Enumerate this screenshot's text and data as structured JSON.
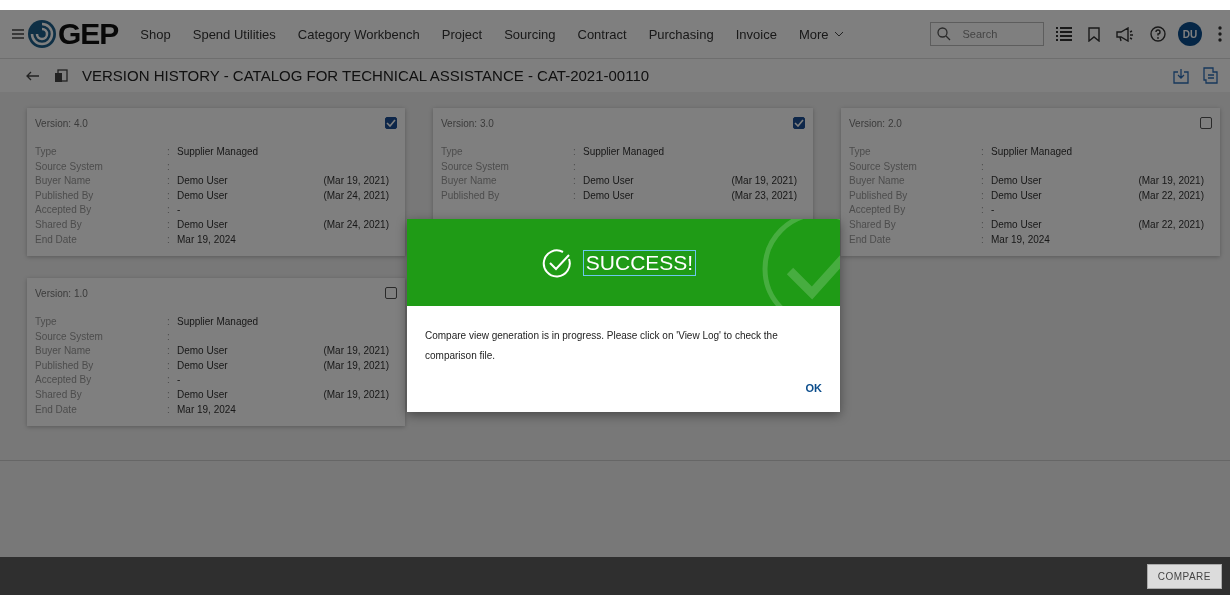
{
  "header": {
    "logo": "GEP",
    "nav": [
      "Shop",
      "Spend Utilities",
      "Category Workbench",
      "Project",
      "Sourcing",
      "Contract",
      "Purchasing",
      "Invoice"
    ],
    "more": "More",
    "search": {
      "placeholder": "Search"
    },
    "avatar": "DU"
  },
  "title": "VERSION HISTORY - CATALOG FOR TECHNICAL ASSISTANCE - CAT-2021-00110",
  "cards": [
    {
      "version": "Version: 4.0",
      "checked": true,
      "rows": [
        {
          "label": "Type",
          "sep": ":",
          "value": "Supplier Managed"
        },
        {
          "label": "Source System",
          "sep": ":"
        },
        {
          "label": "Buyer Name",
          "sep": ":",
          "value": "Demo User",
          "date": "(Mar 19, 2021)"
        },
        {
          "label": "Published By",
          "sep": ":",
          "value": "Demo User",
          "date": "(Mar 24, 2021)"
        },
        {
          "label": "Accepted By",
          "sep": ":",
          "value": "-"
        },
        {
          "label": "Shared By",
          "sep": ":",
          "value": "Demo User",
          "date": "(Mar 24, 2021)"
        },
        {
          "label": "End Date",
          "sep": ":",
          "value": "Mar 19, 2024"
        }
      ]
    },
    {
      "version": "Version: 3.0",
      "checked": true,
      "rows": [
        {
          "label": "Type",
          "sep": ":",
          "value": "Supplier Managed"
        },
        {
          "label": "Source System",
          "sep": ":"
        },
        {
          "label": "Buyer Name",
          "sep": ":",
          "value": "Demo User",
          "date": "(Mar 19, 2021)"
        },
        {
          "label": "Published By",
          "sep": ":",
          "value": "Demo User",
          "date": "(Mar 23, 2021)"
        }
      ]
    },
    {
      "version": "Version: 2.0",
      "checked": false,
      "rows": [
        {
          "label": "Type",
          "sep": ":",
          "value": "Supplier Managed"
        },
        {
          "label": "Source System",
          "sep": ":"
        },
        {
          "label": "Buyer Name",
          "sep": ":",
          "value": "Demo User",
          "date": "(Mar 19, 2021)"
        },
        {
          "label": "Published By",
          "sep": ":",
          "value": "Demo User",
          "date": "(Mar 22, 2021)"
        },
        {
          "label": "Accepted By",
          "sep": ":",
          "value": "-"
        },
        {
          "label": "Shared By",
          "sep": ":",
          "value": "Demo User",
          "date": "(Mar 22, 2021)"
        },
        {
          "label": "End Date",
          "sep": ":",
          "value": "Mar 19, 2024"
        }
      ]
    },
    {
      "version": "Version: 1.0",
      "checked": false,
      "rows": [
        {
          "label": "Type",
          "sep": ":",
          "value": "Supplier Managed"
        },
        {
          "label": "Source System",
          "sep": ":"
        },
        {
          "label": "Buyer Name",
          "sep": ":",
          "value": "Demo User",
          "date": "(Mar 19, 2021)"
        },
        {
          "label": "Published By",
          "sep": ":",
          "value": "Demo User",
          "date": "(Mar 19, 2021)"
        },
        {
          "label": "Accepted By",
          "sep": ":",
          "value": "-"
        },
        {
          "label": "Shared By",
          "sep": ":",
          "value": "Demo User",
          "date": "(Mar 19, 2021)"
        },
        {
          "label": "End Date",
          "sep": ":",
          "value": "Mar 19, 2024"
        }
      ]
    }
  ],
  "dialog": {
    "title": "SUCCESS!",
    "message": "Compare view generation is in progress. Please click on 'View Log' to check the comparison file.",
    "button": "OK"
  },
  "footer": {
    "button": "COMPARE"
  }
}
